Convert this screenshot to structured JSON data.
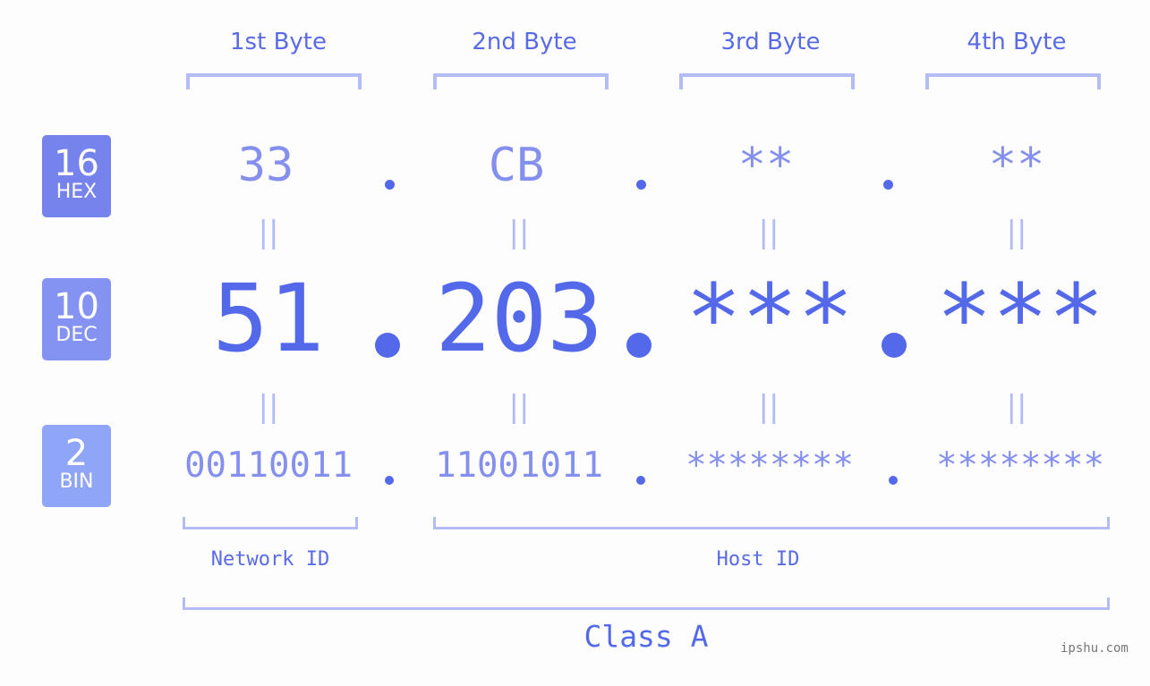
{
  "bytes": [
    {
      "label": "1st Byte",
      "hex": "33",
      "dec": "51",
      "bin": "00110011"
    },
    {
      "label": "2nd Byte",
      "hex": "CB",
      "dec": "203",
      "bin": "11001011"
    },
    {
      "label": "3rd Byte",
      "hex": "**",
      "dec": "***",
      "bin": "********"
    },
    {
      "label": "4th Byte",
      "hex": "**",
      "dec": "***",
      "bin": "********"
    }
  ],
  "bases": [
    {
      "num": "16",
      "name": "HEX",
      "color": "#7683ed"
    },
    {
      "num": "10",
      "name": "DEC",
      "color": "#8493f2"
    },
    {
      "num": "2",
      "name": "BIN",
      "color": "#8fa5f8"
    }
  ],
  "separator": ".",
  "equals": "||",
  "network_id_label": "Network ID",
  "host_id_label": "Host ID",
  "class_label": "Class A",
  "credit": "ipshu.com"
}
